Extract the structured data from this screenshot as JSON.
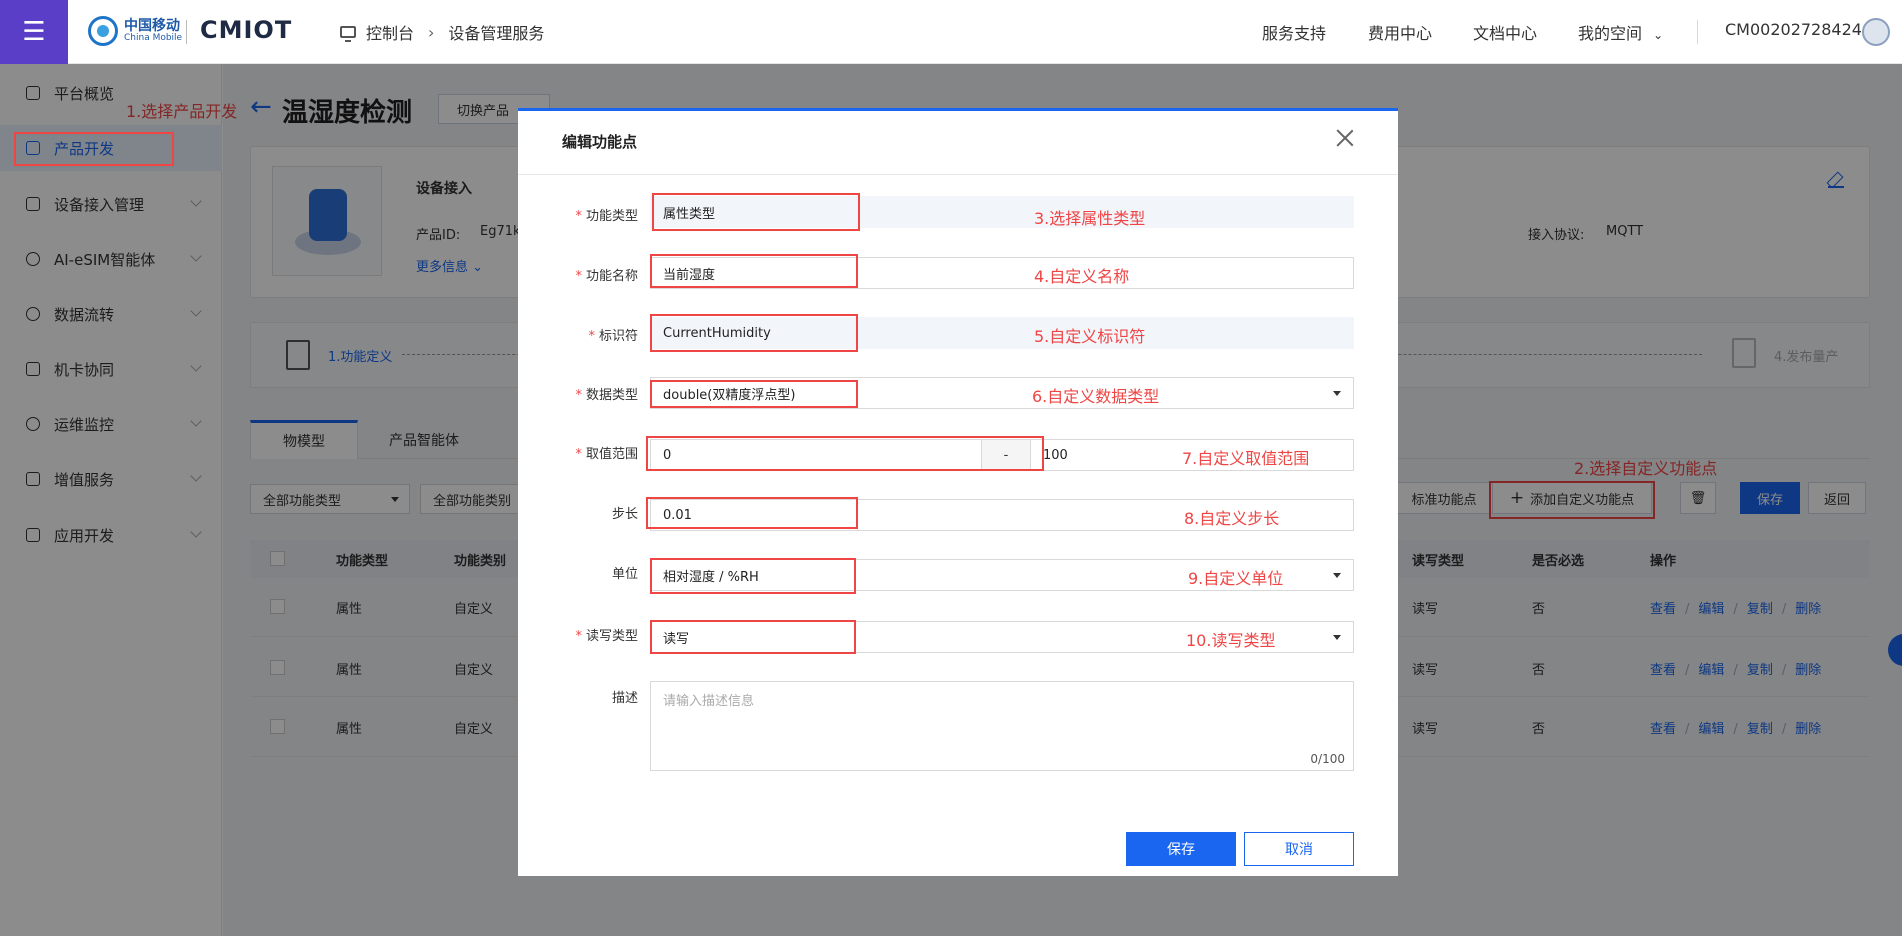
{
  "header": {
    "brand_cn": "中国移动",
    "brand_en": "China Mobile",
    "platform_logo": "CMIOT",
    "breadcrumb": [
      "控制台",
      "设备管理服务"
    ],
    "nav": [
      "服务支持",
      "费用中心",
      "文档中心",
      "我的空间"
    ],
    "account": "CM002027284244"
  },
  "sidebar": {
    "items": [
      {
        "label": "平台概览",
        "icon": "dashboard-icon"
      },
      {
        "label": "产品开发",
        "icon": "cube-icon"
      },
      {
        "label": "设备接入管理",
        "icon": "device-access-icon"
      },
      {
        "label": "AI-eSIM智能体",
        "icon": "ai-icon"
      },
      {
        "label": "数据流转",
        "icon": "data-flow-icon"
      },
      {
        "label": "机卡协同",
        "icon": "sim-card-icon"
      },
      {
        "label": "运维监控",
        "icon": "monitor-icon"
      },
      {
        "label": "增值服务",
        "icon": "value-added-icon"
      },
      {
        "label": "应用开发",
        "icon": "apps-icon"
      }
    ]
  },
  "annotations": {
    "a1": "1.选择产品开发",
    "a2": "2.选择自定义功能点",
    "a3": "3.选择属性类型",
    "a4": "4.自定义名称",
    "a5": "5.自定义标识符",
    "a6": "6.自定义数据类型",
    "a7": "7.自定义取值范围",
    "a8": "8.自定义步长",
    "a9": "9.自定义单位",
    "a10": "10.读写类型"
  },
  "page": {
    "title": "温湿度检测",
    "switch_product": "切换产品",
    "device_access": "设备接入",
    "product_id_label": "产品ID:",
    "product_id_value": "Eg71k",
    "more_info": "更多信息",
    "protocol_label": "接入协议:",
    "protocol_value": "MQTT",
    "step1": "1.功能定义",
    "step4": "4.发布量产",
    "tab_model": "物模型",
    "tab_ai": "产品智能体",
    "filter_type": "全部功能类型",
    "filter_category": "全部功能类别",
    "btn_std": "标准功能点",
    "btn_add": "添加自定义功能点",
    "btn_save": "保存",
    "btn_back": "返回"
  },
  "table": {
    "headers": {
      "type": "功能类型",
      "category": "功能类别",
      "rw": "读写类型",
      "required": "是否必选",
      "ops": "操作"
    },
    "rows": [
      {
        "type": "属性",
        "category": "自定义",
        "rw": "读写",
        "required": "否"
      },
      {
        "type": "属性",
        "category": "自定义",
        "rw": "读写",
        "required": "否"
      },
      {
        "type": "属性",
        "category": "自定义",
        "rw": "读写",
        "required": "否"
      }
    ],
    "ops": [
      "查看",
      "编辑",
      "复制",
      "删除"
    ]
  },
  "modal": {
    "title": "编辑功能点",
    "labels": {
      "func_type": "功能类型",
      "func_name": "功能名称",
      "identifier": "标识符",
      "data_type": "数据类型",
      "range": "取值范围",
      "step": "步长",
      "unit": "单位",
      "rw_type": "读写类型",
      "desc": "描述"
    },
    "values": {
      "func_type": "属性类型",
      "func_name": "当前湿度",
      "identifier": "CurrentHumidity",
      "data_type": "double(双精度浮点型)",
      "range_min": "0",
      "range_sep": "-",
      "range_max": "100",
      "step": "0.01",
      "unit": "相对湿度 / %RH",
      "rw_type": "读写"
    },
    "desc_placeholder": "请输入描述信息",
    "desc_counter": "0/100",
    "save": "保存",
    "cancel": "取消"
  },
  "colors": {
    "accent": "#1a66f0",
    "annotation": "#f04545",
    "menu": "#5a3ec8"
  }
}
